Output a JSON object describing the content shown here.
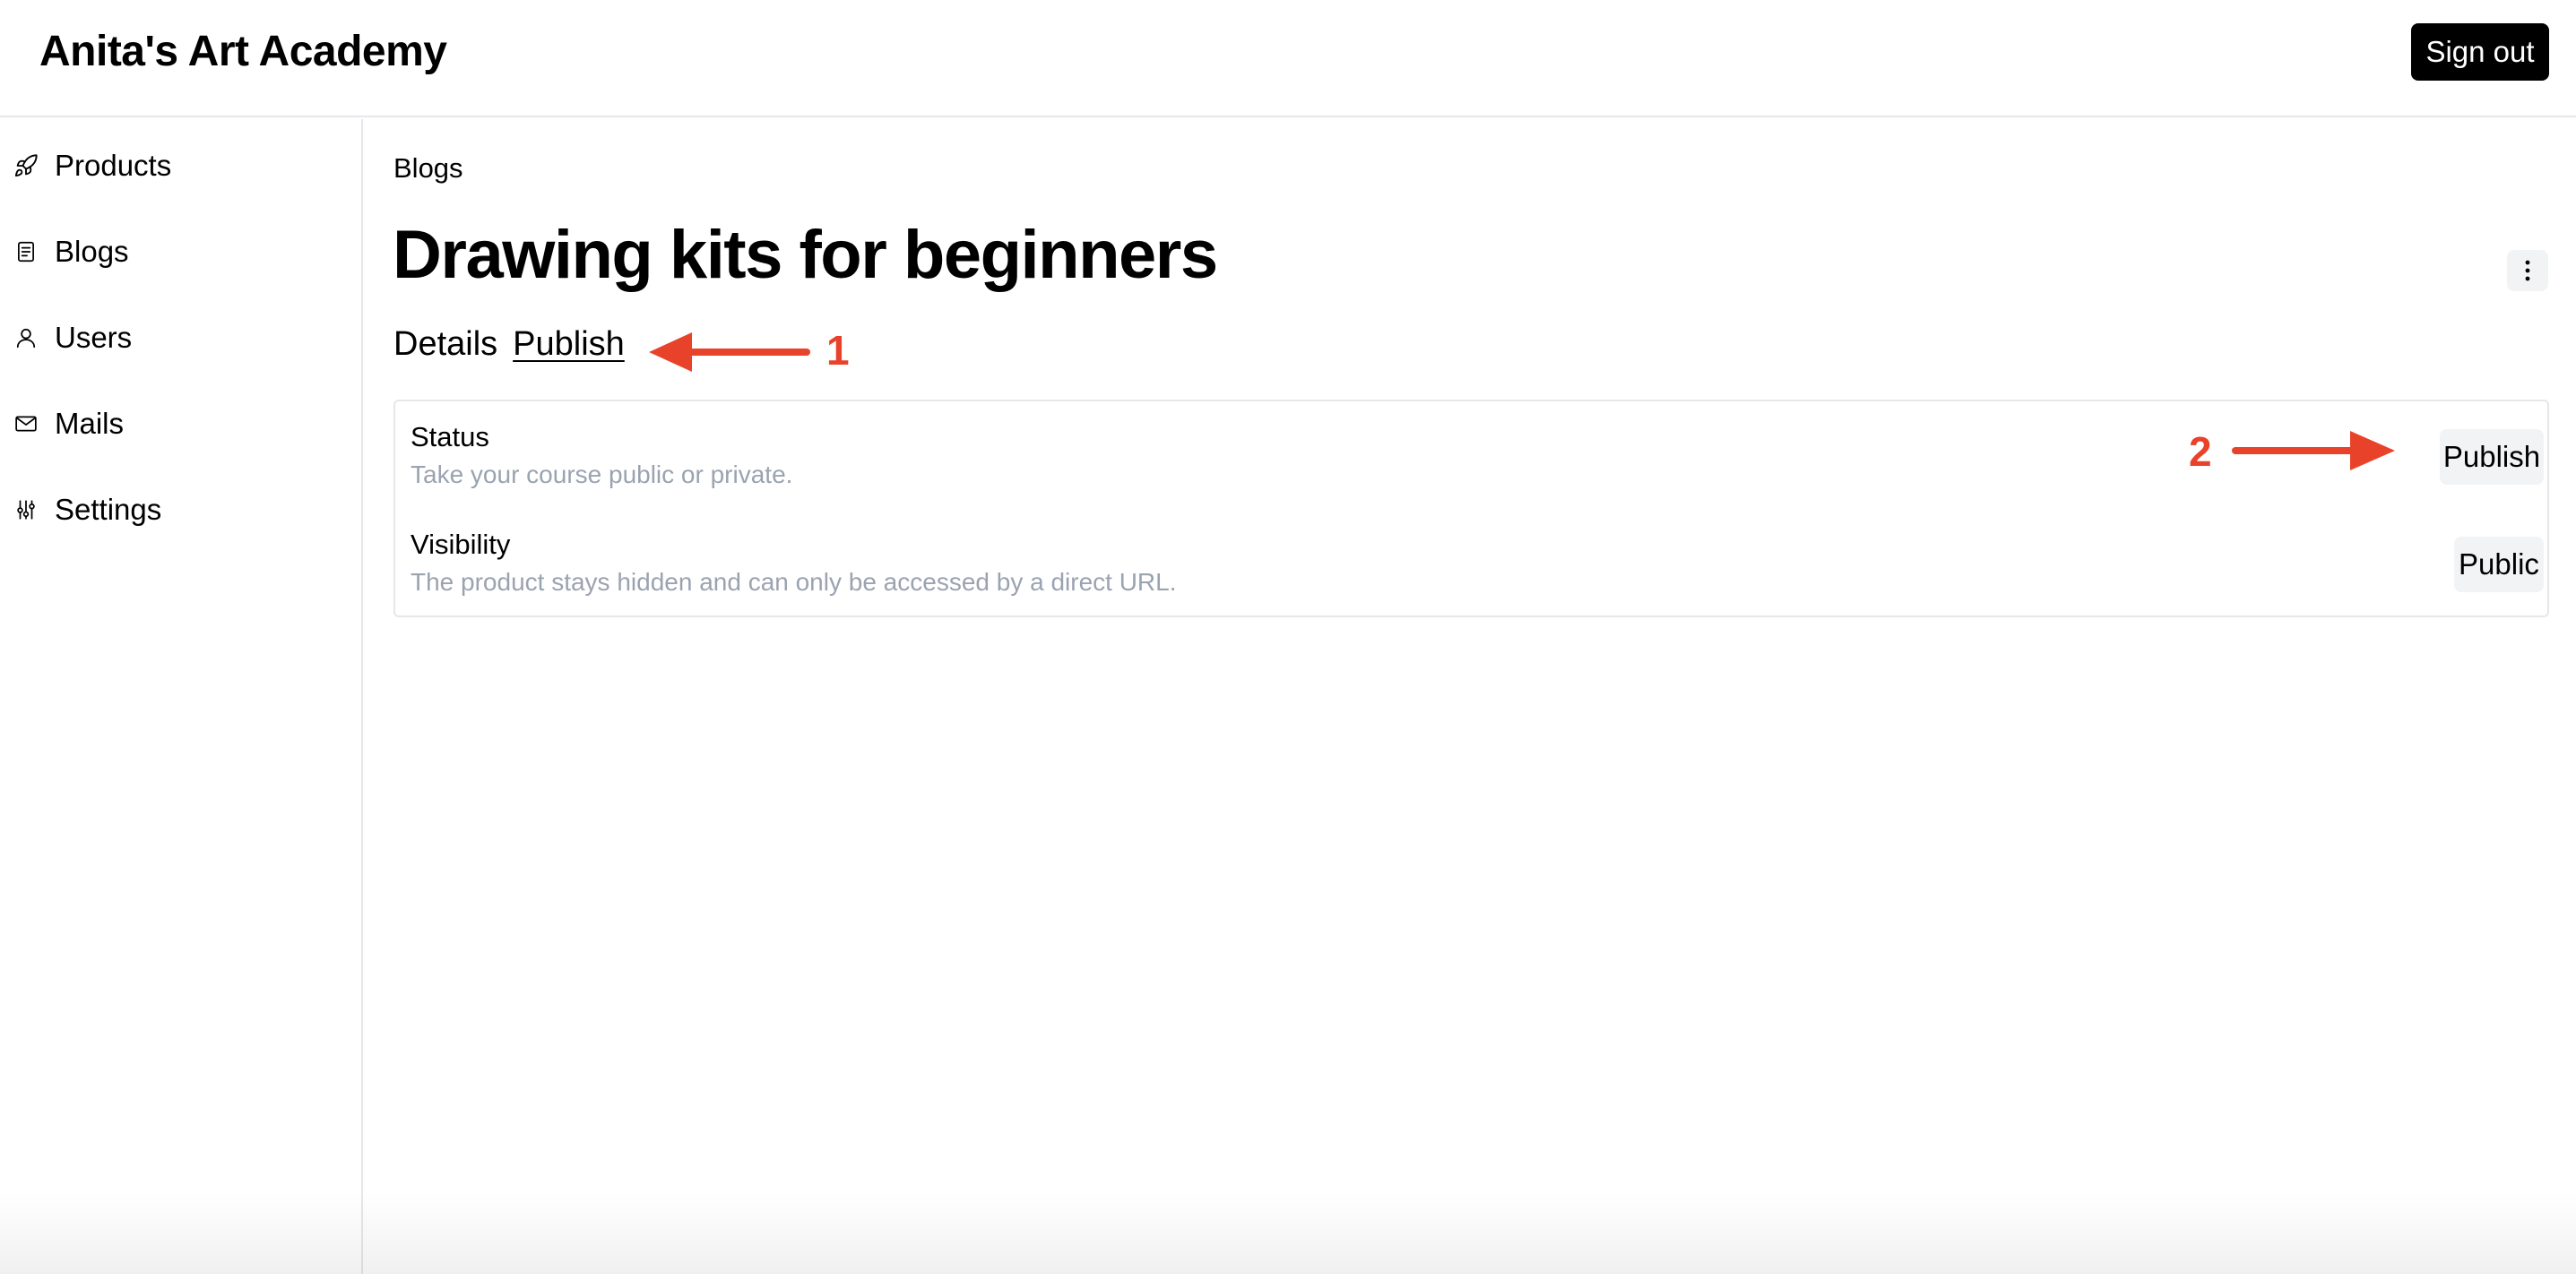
{
  "app": {
    "title": "Anita's Art Academy",
    "sign_out_label": "Sign out"
  },
  "sidebar": {
    "items": [
      {
        "label": "Products",
        "icon": "rocket-icon"
      },
      {
        "label": "Blogs",
        "icon": "document-icon"
      },
      {
        "label": "Users",
        "icon": "user-icon"
      },
      {
        "label": "Mails",
        "icon": "mail-icon"
      },
      {
        "label": "Settings",
        "icon": "sliders-icon"
      }
    ]
  },
  "main": {
    "breadcrumb": "Blogs",
    "title": "Drawing kits for beginners",
    "tabs": [
      {
        "label": "Details",
        "active": false
      },
      {
        "label": "Publish",
        "active": true
      }
    ],
    "rows": [
      {
        "title": "Status",
        "description": "Take your course public or private.",
        "action": "Publish"
      },
      {
        "title": "Visibility",
        "description": "The product stays hidden and can only be accessed by a direct URL.",
        "action": "Public"
      }
    ]
  },
  "annotations": {
    "first": "1",
    "second": "2",
    "color": "#e8432a"
  }
}
